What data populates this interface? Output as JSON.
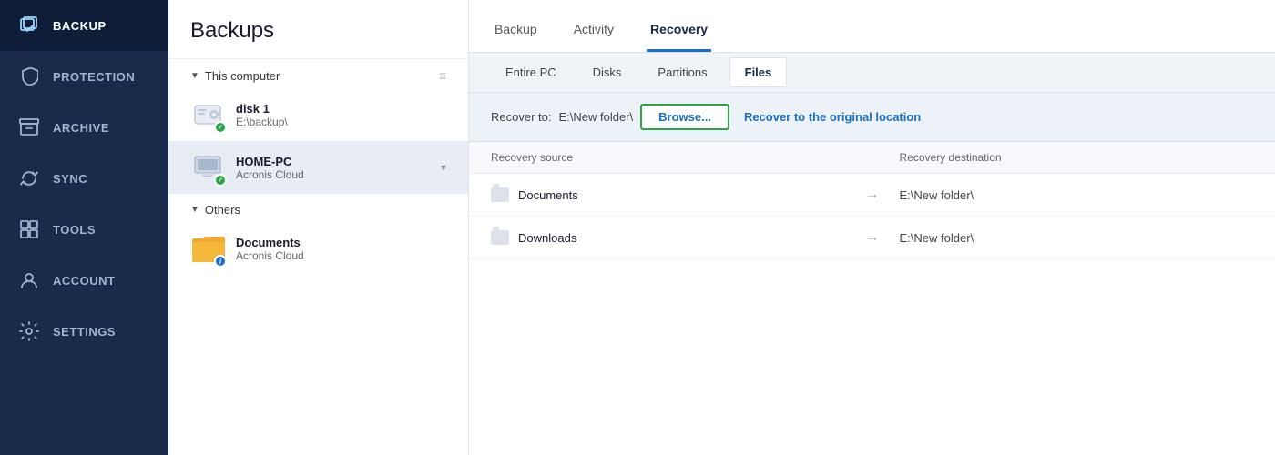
{
  "sidebar": {
    "items": [
      {
        "id": "backup",
        "label": "Backup",
        "active": true,
        "icon": "backup-icon"
      },
      {
        "id": "protection",
        "label": "Protection",
        "active": false,
        "icon": "shield-icon"
      },
      {
        "id": "archive",
        "label": "Archive",
        "active": false,
        "icon": "archive-icon"
      },
      {
        "id": "sync",
        "label": "Sync",
        "active": false,
        "icon": "sync-icon"
      },
      {
        "id": "tools",
        "label": "Tools",
        "active": false,
        "icon": "tools-icon"
      },
      {
        "id": "account",
        "label": "Account",
        "active": false,
        "icon": "account-icon"
      },
      {
        "id": "settings",
        "label": "Settings",
        "active": false,
        "icon": "settings-icon"
      }
    ]
  },
  "backup_panel": {
    "title": "Backups",
    "sections": [
      {
        "id": "this-computer",
        "label": "This computer",
        "items": [
          {
            "id": "disk1",
            "name": "disk 1",
            "sub": "E:\\backup\\",
            "status": "ok",
            "icon": "disk-icon"
          },
          {
            "id": "home-pc",
            "name": "HOME-PC",
            "sub": "Acronis Cloud",
            "status": "ok",
            "icon": "monitor-icon",
            "selected": true,
            "expandable": true
          }
        ]
      },
      {
        "id": "others",
        "label": "Others",
        "items": [
          {
            "id": "documents",
            "name": "Documents",
            "sub": "Acronis Cloud",
            "status": "info",
            "icon": "folder-icon"
          }
        ]
      }
    ]
  },
  "tabs": {
    "top": [
      {
        "id": "backup",
        "label": "Backup",
        "active": false
      },
      {
        "id": "activity",
        "label": "Activity",
        "active": false
      },
      {
        "id": "recovery",
        "label": "Recovery",
        "active": true
      }
    ],
    "sub": [
      {
        "id": "entire-pc",
        "label": "Entire PC",
        "active": false
      },
      {
        "id": "disks",
        "label": "Disks",
        "active": false
      },
      {
        "id": "partitions",
        "label": "Partitions",
        "active": false
      },
      {
        "id": "files",
        "label": "Files",
        "active": true
      }
    ]
  },
  "recover_bar": {
    "label": "Recover to:",
    "path": "E:\\New folder\\",
    "browse_label": "Browse...",
    "original_label": "Recover to the original location"
  },
  "recovery_table": {
    "col_source": "Recovery source",
    "col_dest": "Recovery destination",
    "rows": [
      {
        "id": "documents",
        "name": "Documents",
        "dest": "E:\\New folder\\"
      },
      {
        "id": "downloads",
        "name": "Downloads",
        "dest": "E:\\New folder\\"
      }
    ]
  }
}
